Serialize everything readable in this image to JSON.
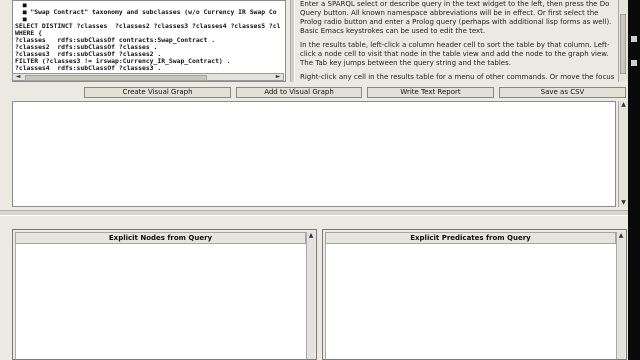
{
  "query_editor": {
    "lines": [
      "  ■",
      "  ■ \"Swap Contract\" taxonomy and subclasses (w/o Currency IR Swap Co",
      "  ■",
      "SELECT DISTINCT ?classes  ?classes2 ?classes3 ?classes4 ?classes5 ?cl",
      "WHERE {",
      "?classes   rdfs:subClassOf contracts:Swap_Contract .",
      "?classes2  rdfs:subClassOf ?classes .",
      "?classes3  rdfs:subClassOf ?classes2 .",
      "FILTER (?classes3 != irswap:Currency_IR_Swap_Contract) .",
      "?classes4  rdfs:subClassOf ?classes3 ."
    ]
  },
  "help": {
    "paragraphs": [
      "Enter a SPARQL select or describe query in the text widget to the left, then press the Do Query button.  All known namespace abbreviations will be in effect.  Or first select the Prolog radio button and enter a Prolog query (perhaps with additional lisp forms as well).  Basic Emacs keystrokes can be used to edit the text.",
      "In the results table, left-click a column header cell to sort the table by that column.  Left-click a node cell to visit that node in the table view and add the node to the graph view.  The Tab key jumps between the query string and the tables.",
      "Right-click any cell in the results table for a menu of other commands.  Or move the focus with the"
    ]
  },
  "buttons": {
    "create_visual_graph": "Create Visual Graph",
    "add_to_visual_graph": "Add to Visual Graph",
    "write_text_report": "Write Text Report",
    "save_as_csv": "Save as CSV"
  },
  "panels": {
    "nodes_title": "Explicit Nodes from Query",
    "predicates_title": "Explicit Predicates from Query"
  },
  "icons": {
    "scroll_up": "▲",
    "scroll_down": "▼",
    "scroll_left": "◄",
    "scroll_right": "►"
  }
}
